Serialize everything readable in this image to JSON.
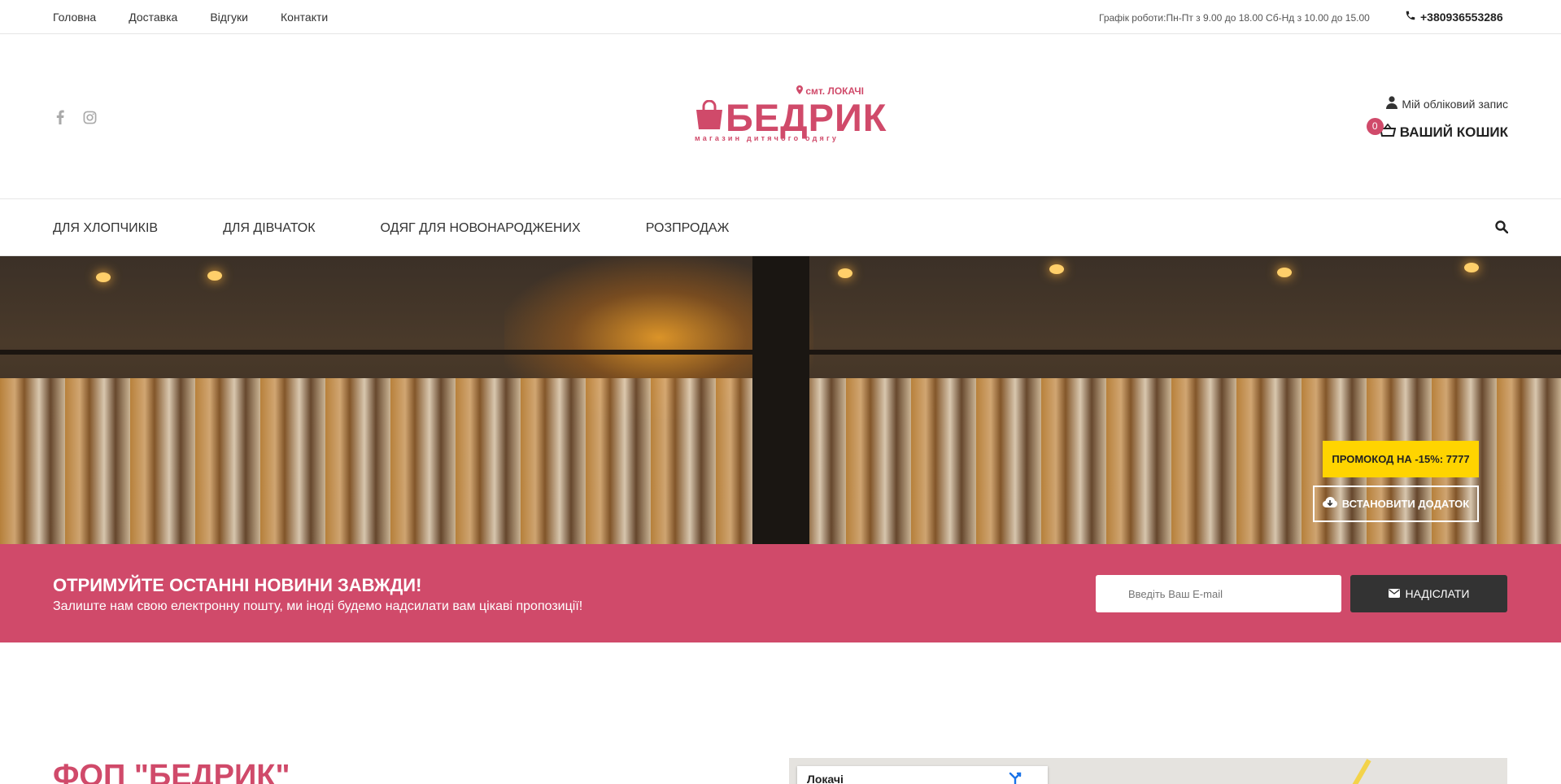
{
  "topbar": {
    "nav": [
      "Головна",
      "Доставка",
      "Відгуки",
      "Контакти"
    ],
    "hours": "Графік роботи:Пн-Пт з 9.00 до 18.00 Сб-Нд з 10.00 до 15.00",
    "phone": "+380936553286"
  },
  "logo": {
    "location": "смт. ЛОКАЧІ",
    "name": "БЕДРИК",
    "subtitle": "магазин дитячого одягу"
  },
  "header": {
    "account": "Мій обліковий запис",
    "cart_label": "ВАШИЙ КОШИК",
    "cart_count": "0"
  },
  "catnav": {
    "items": [
      "ДЛЯ ХЛОПЧИКІВ",
      "ДЛЯ ДІВЧАТОК",
      "ОДЯГ ДЛЯ НОВОНАРОДЖЕНИХ",
      "РОЗПРОДАЖ"
    ]
  },
  "hero": {
    "promo": "ПРОМОКОД НА -15%: 7777",
    "install": "ВСТАНОВИТИ ДОДАТОК"
  },
  "newsletter": {
    "title": "ОТРИМУЙТЕ ОСТАННІ НОВИНИ ЗАВЖДИ!",
    "text": "Залиште нам свою електронну пошту, ми іноді будемо надсилати вам цікаві пропозиції!",
    "placeholder": "Введіть Ваш E-mail",
    "send": "НАДІСЛАТИ"
  },
  "about": {
    "title": "ФОП \"БЕДРИК\""
  },
  "map": {
    "place": "Локачі"
  },
  "colors": {
    "brand": "#d04a6a",
    "promo": "#ffd400",
    "dark_button": "#333333"
  }
}
